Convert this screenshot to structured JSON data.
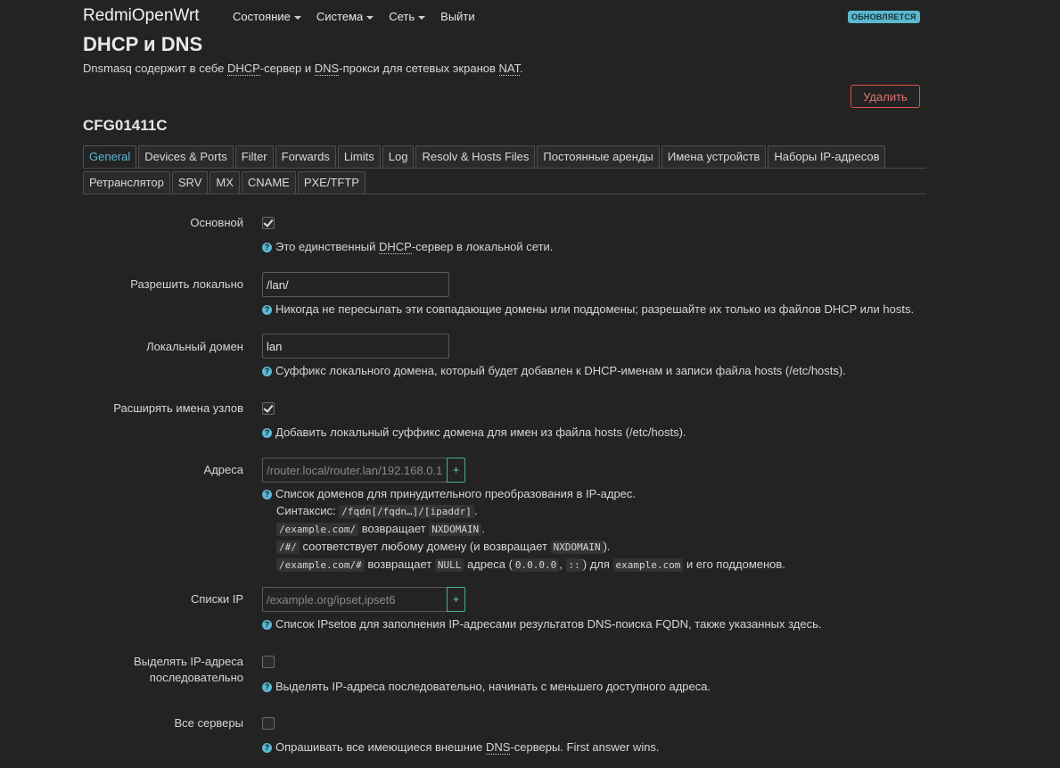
{
  "topbar": {
    "brand": "RedmiOpenWrt",
    "nav": [
      "Состояние",
      "Система",
      "Сеть",
      "Выйти"
    ],
    "status": "ОБНОВЛЯЕТСЯ"
  },
  "page": {
    "title": "DHCP и DNS",
    "desc_prefix": "Dnsmasq содержит в себе ",
    "desc_dhcp": "DHCP",
    "desc_mid": "-сервер и ",
    "desc_dns": "DNS",
    "desc_mid2": "-прокси для сетевых экранов ",
    "desc_nat": "NAT",
    "desc_end": ".",
    "delete_label": "Удалить",
    "section": "CFG01411C"
  },
  "tabs_row1": [
    "General",
    "Devices & Ports",
    "Filter",
    "Forwards",
    "Limits",
    "Log",
    "Resolv & Hosts Files",
    "Постоянные аренды",
    "Имена устройств",
    "Наборы IP-адресов"
  ],
  "tabs_row2": [
    "Ретранслятор",
    "SRV",
    "MX",
    "CNAME",
    "PXE/TFTP"
  ],
  "fields": {
    "authoritative": {
      "label": "Основной",
      "checked": true,
      "help_prefix": "Это единственный ",
      "help_abbr": "DHCP",
      "help_suffix": "-сервер в локальной сети."
    },
    "local": {
      "label": "Разрешить локально",
      "value": "/lan/",
      "help": "Никогда не пересылать эти совпадающие домены или поддомены; разрешайте их только из файлов DHCP или hosts."
    },
    "domain": {
      "label": "Локальный домен",
      "value": "lan",
      "help": "Суффикс локального домена, который будет добавлен к DHCP-именам и записи файла hosts (/etc/hosts)."
    },
    "expandhosts": {
      "label": "Расширять имена узлов",
      "checked": true,
      "help": "Добавить локальный суффикс домена для имен из файла hosts (/etc/hosts)."
    },
    "address": {
      "label": "Адреса",
      "placeholder": "/router.local/router.lan/192.168.0.1",
      "add": "+",
      "help": "Список доменов для принудительного преобразования в IP-адрес.",
      "syntax_label": "Синтаксис:",
      "syntax_code": "/fqdn[/fqdn…]/[ipaddr]",
      "ex1_code": "/example.com/",
      "ex1_text": "возвращает",
      "ex1_code2": "NXDOMAIN",
      "ex2_code": "/#/",
      "ex2_text": "соответствует любому домену (и возвращает",
      "ex2_code2": "NXDOMAIN",
      "ex2_end": ").",
      "ex3_code": "/example.com/#",
      "ex3_text": "возвращает",
      "ex3_code2": "NULL",
      "ex3_text2": "адреса (",
      "ex3_code3": "0.0.0.0",
      "ex3_comma": ",",
      "ex3_code4": "::",
      "ex3_text3": ") для",
      "ex3_code5": "example.com",
      "ex3_end": "и его поддоменов."
    },
    "ipset": {
      "label": "Списки IP",
      "placeholder": "/example.org/ipset,ipset6",
      "add": "+",
      "help": "Список IPsetов для заполнения IP-адресами результатов DNS-поиска FQDN, также указанных здесь."
    },
    "sequential": {
      "label_line1": "Выделять IP-адреса",
      "label_line2": "последовательно",
      "checked": false,
      "help": "Выделять IP-адреса последовательно, начинать с меньшего доступного адреса."
    },
    "allservers": {
      "label": "Все серверы",
      "checked": false,
      "help_prefix": "Опрашивать все имеющиеся внешние ",
      "help_abbr": "DNS",
      "help_suffix": "-серверы. First answer wins."
    }
  },
  "colors": {
    "background": "#232323",
    "accent": "#5bb8d5",
    "danger": "#d9534f",
    "add": "#4caf7a"
  }
}
